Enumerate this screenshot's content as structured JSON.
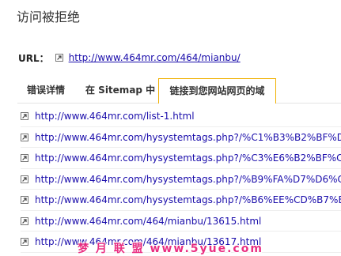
{
  "page": {
    "title": "访问被拒绝"
  },
  "url_row": {
    "label": "URL：",
    "link": "http://www.464mr.com/464/mianbu/"
  },
  "tabs": [
    {
      "label": "错误详情",
      "active": false
    },
    {
      "label": "在 Sitemap 中",
      "active": false
    },
    {
      "label": "链接到您网站网页的域",
      "active": true
    }
  ],
  "links": [
    "http://www.464mr.com/list-1.html",
    "http://www.464mr.com/hysystemtags.php?/%C1%B3%B2%BF%D",
    "http://www.464mr.com/hysystemtags.php?/%C3%E6%B2%BF%C",
    "http://www.464mr.com/hysystemtags.php?/%B9%FA%D7%D6%C",
    "http://www.464mr.com/hysystemtags.php?/%B6%EE%CD%B7%E",
    "http://www.464mr.com/464/mianbu/13615.html",
    "http://www.464mr.com/464/mianbu/13617.html"
  ],
  "watermark": "梦 月 联 盟  www.5yue.com",
  "colors": {
    "link": "#1a0dab",
    "active_tab_border": "#f0b000",
    "watermark": "#e91e78"
  },
  "icons": {
    "external_link": "external-link-icon"
  }
}
